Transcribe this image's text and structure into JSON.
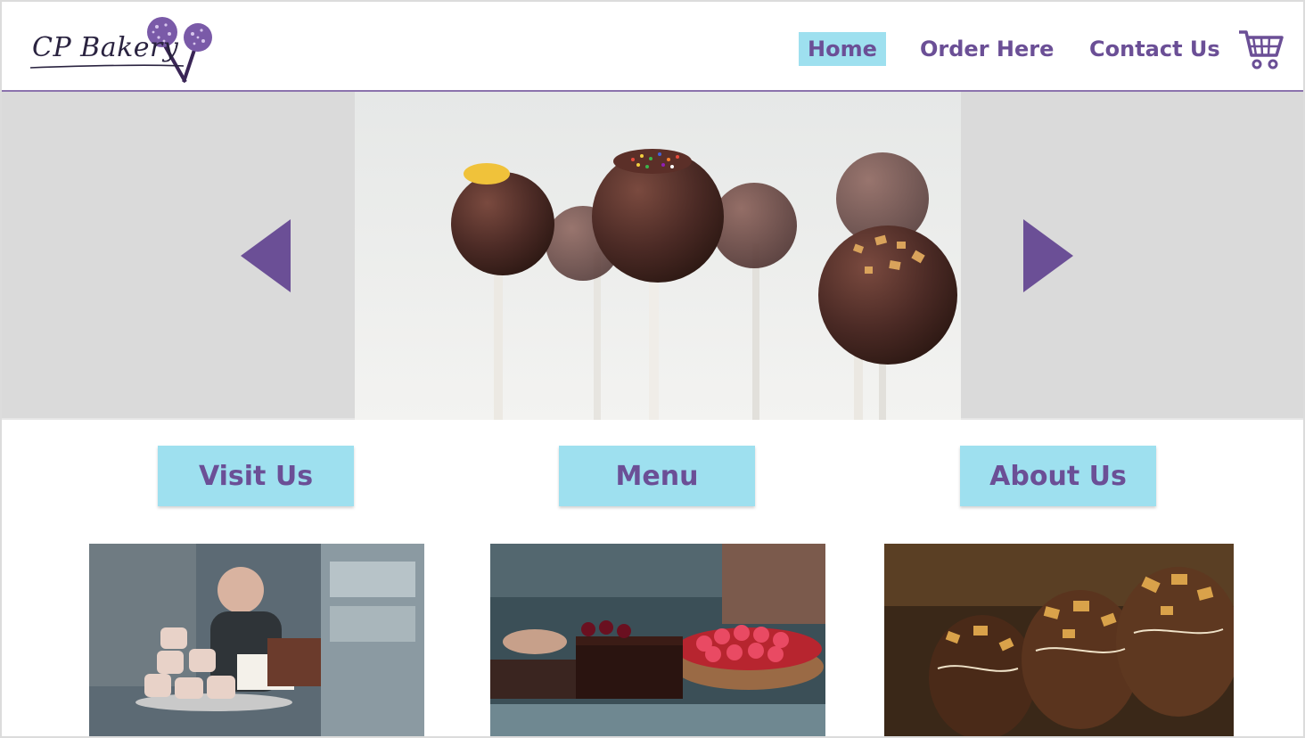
{
  "brand": {
    "logo_text": "CP Bakery"
  },
  "nav": {
    "items": [
      {
        "label": "Home",
        "active": true
      },
      {
        "label": "Order Here",
        "active": false
      },
      {
        "label": "Contact Us",
        "active": false
      }
    ],
    "cart_icon": "shopping-cart-icon"
  },
  "carousel": {
    "image": "chocolate cake pops",
    "prev_icon": "triangle-left",
    "next_icon": "triangle-right"
  },
  "buttons": {
    "visit_label": "Visit Us",
    "menu_label": "Menu",
    "about_label": "About Us"
  },
  "photos": [
    {
      "subject": "baker with cakes"
    },
    {
      "subject": "berry tart display"
    },
    {
      "subject": "nut covered chocolate pastries"
    }
  ],
  "colors": {
    "accent": "#6b4f96",
    "button_bg": "#9ee0ef",
    "carousel_bg": "#dadada"
  }
}
